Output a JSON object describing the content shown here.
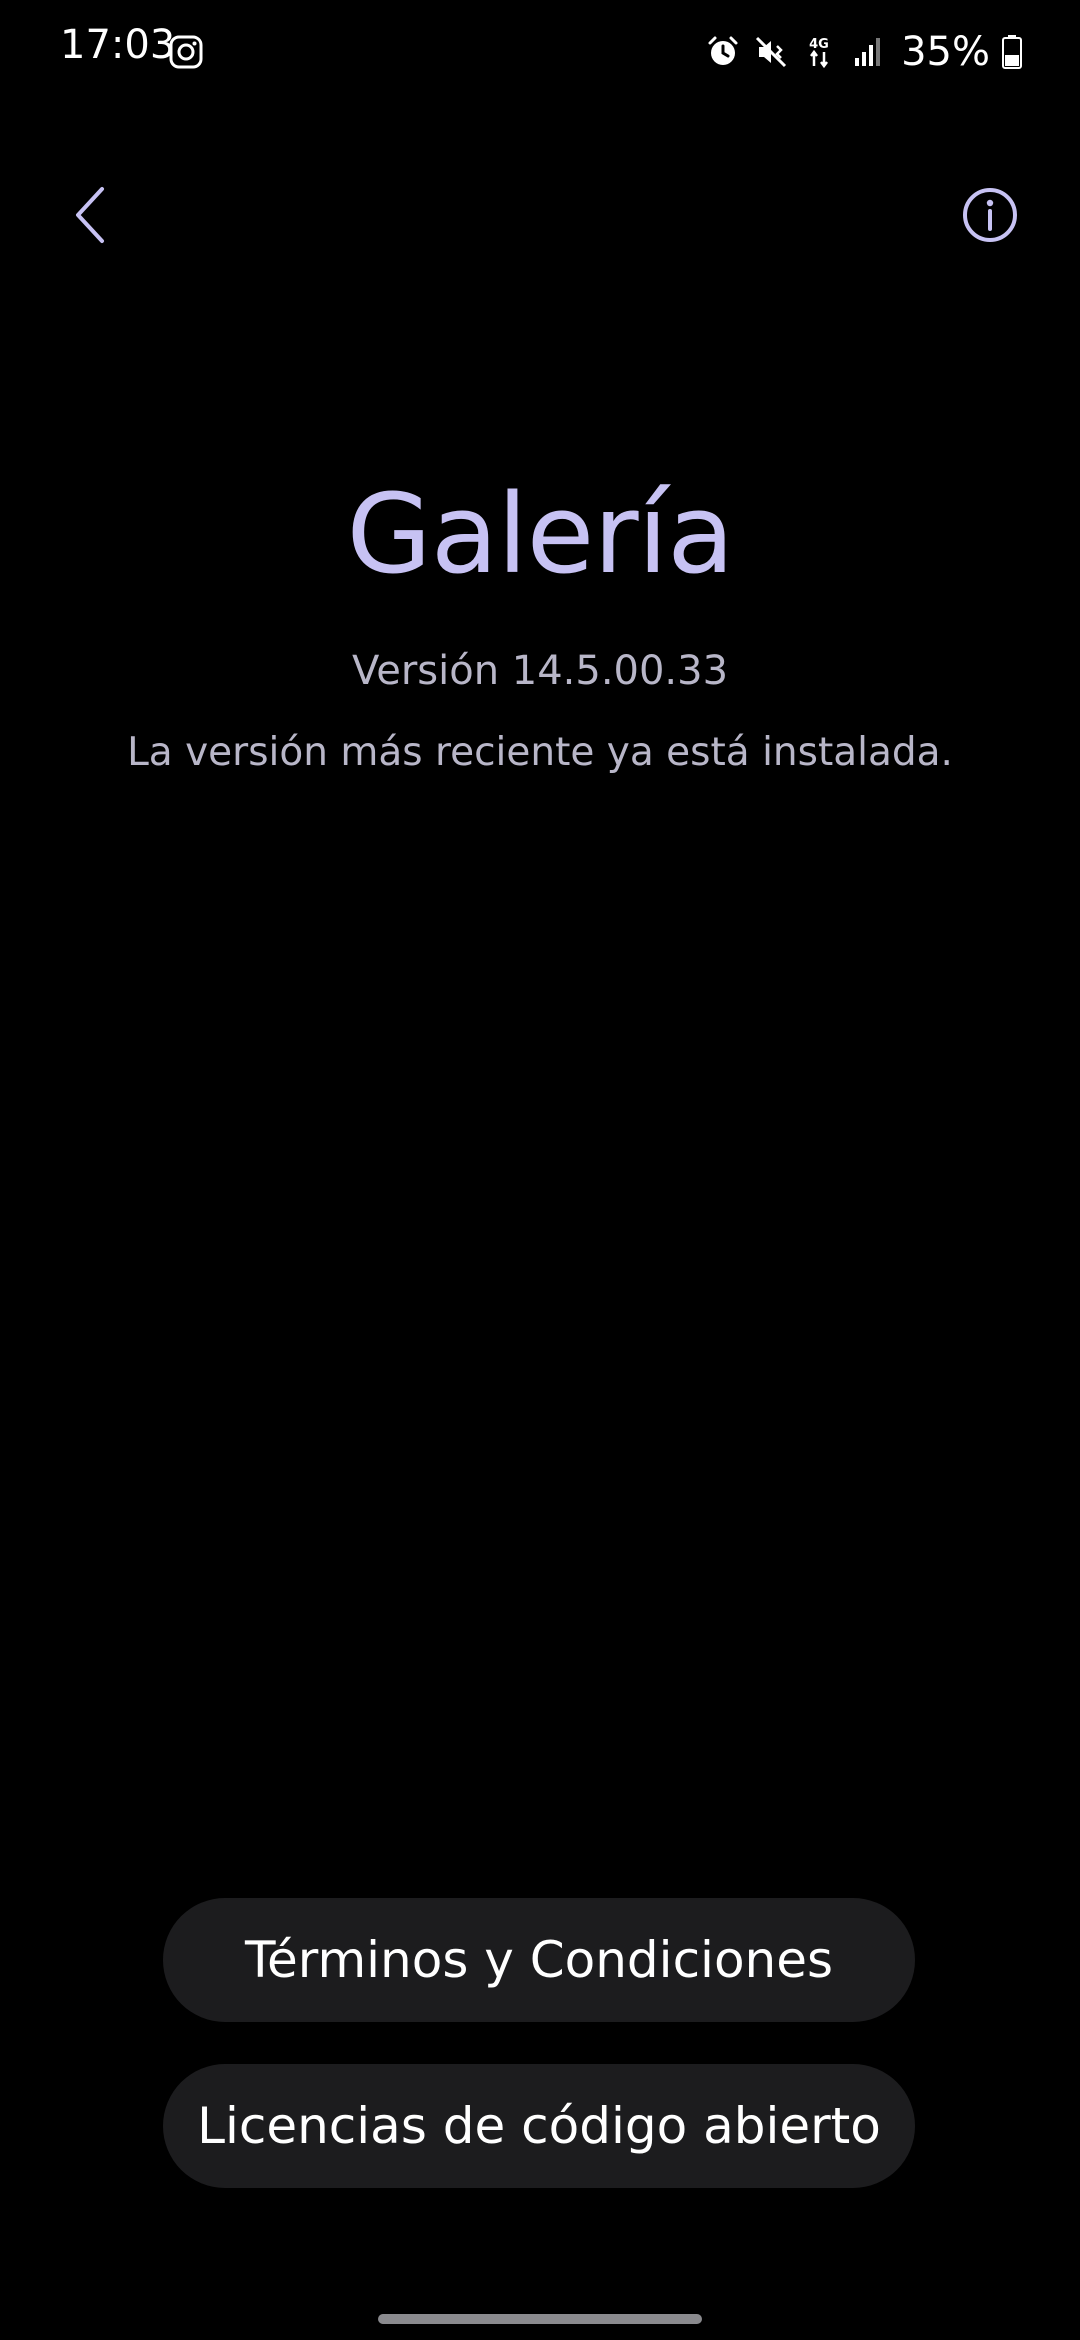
{
  "status_bar": {
    "time": "17:03",
    "battery_percent": "35%",
    "network_label": "4G"
  },
  "colors": {
    "background": "#000000",
    "accent": "#c7c2f3",
    "secondary_text": "#b8b6c8",
    "button_bg": "#1c1c1e"
  },
  "header": {
    "back_icon": "chevron-left-icon",
    "info_icon": "info-icon"
  },
  "app": {
    "name": "Galería",
    "version": "Versión 14.5.00.33",
    "update_status": "La versión más reciente ya está instalada."
  },
  "buttons": {
    "terms": "Términos y Condiciones",
    "licenses": "Licencias de código abierto"
  }
}
